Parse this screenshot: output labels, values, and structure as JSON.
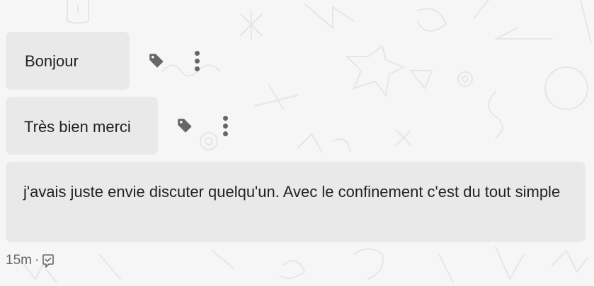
{
  "messages": [
    {
      "text": "Bonjour"
    },
    {
      "text": "Très bien merci"
    },
    {
      "text": "j'avais juste envie discuter quelqu'un. Avec le confinement c'est du tout simple"
    }
  ],
  "message_actions": {
    "tag_icon": "tag-icon",
    "more_icon": "more-vertical-icon"
  },
  "footer": {
    "time": "15m",
    "separator": "·",
    "status_icon": "seen-icon"
  },
  "colors": {
    "background": "#f6f6f6",
    "bubble": "#e9e9e9",
    "icon": "#666666"
  }
}
